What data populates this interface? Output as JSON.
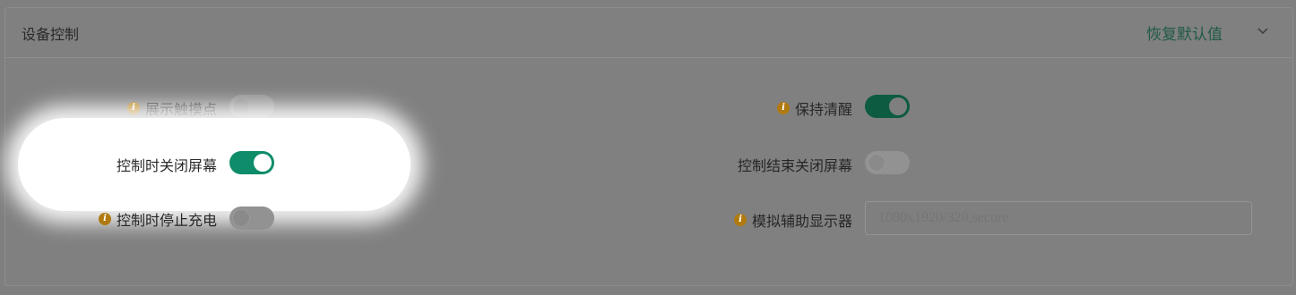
{
  "panel": {
    "title": "设备控制",
    "reset_label": "恢复默认值",
    "chevron_icon": "chevron-down-icon"
  },
  "settings": {
    "show_touches": {
      "label": "展示触摸点",
      "has_info": true,
      "on": false
    },
    "turn_screen_off": {
      "label": "控制时关闭屏幕",
      "has_info": false,
      "on": true
    },
    "stay_awake_no_charge": {
      "label": "控制时停止充电",
      "has_info": true,
      "on": false
    },
    "stay_awake": {
      "label": "保持清醒",
      "has_info": true,
      "on": true
    },
    "power_off_on_close": {
      "label": "控制结束关闭屏幕",
      "has_info": false,
      "on": false
    },
    "virtual_display": {
      "label": "模拟辅助显示器",
      "has_info": true,
      "placeholder": "1080x1920/320,secure"
    }
  },
  "colors": {
    "accent": "#0f8c6a",
    "reset_link": "#215a47",
    "info_icon": "#b07a10"
  }
}
